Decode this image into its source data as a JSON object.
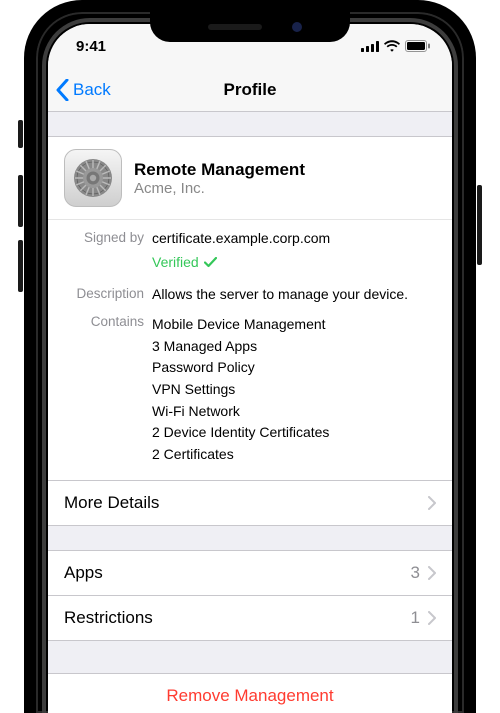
{
  "status": {
    "time": "9:41"
  },
  "nav": {
    "back": "Back",
    "title": "Profile"
  },
  "profile": {
    "title": "Remote Management",
    "org": "Acme, Inc.",
    "signed_by_label": "Signed by",
    "signed_by": "certificate.example.corp.com",
    "verified": "Verified",
    "description_label": "Description",
    "description": "Allows the server to manage your device.",
    "contains_label": "Contains",
    "contains": [
      "Mobile Device Management",
      "3 Managed Apps",
      "Password Policy",
      "VPN Settings",
      "Wi-Fi Network",
      "2 Device Identity Certificates",
      "2 Certificates"
    ]
  },
  "rows": {
    "more_details": "More Details",
    "apps": {
      "label": "Apps",
      "count": "3"
    },
    "restrictions": {
      "label": "Restrictions",
      "count": "1"
    }
  },
  "remove": "Remove Management"
}
